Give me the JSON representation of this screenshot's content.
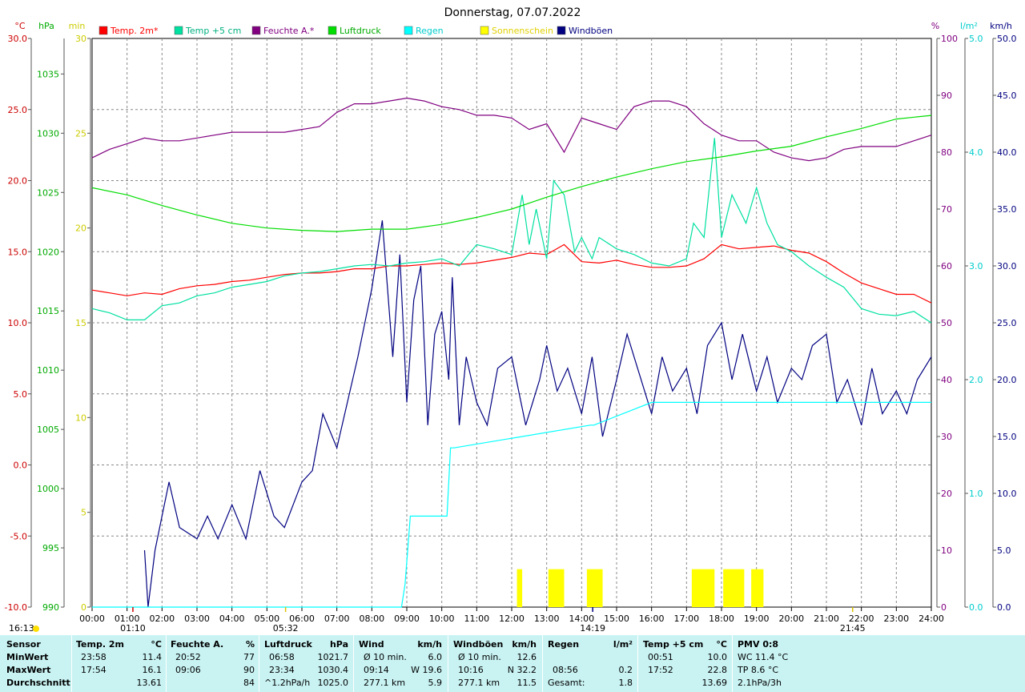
{
  "chart_data": {
    "type": "line",
    "title": "Donnerstag, 07.07.2022",
    "x_ticks": [
      "00:00",
      "01:00",
      "02:00",
      "03:00",
      "04:00",
      "05:00",
      "06:00",
      "07:00",
      "08:00",
      "09:00",
      "10:00",
      "11:00",
      "12:00",
      "13:00",
      "14:00",
      "15:00",
      "16:00",
      "17:00",
      "18:00",
      "19:00",
      "20:00",
      "21:00",
      "22:00",
      "23:00",
      "24:00"
    ],
    "axes": {
      "temp": {
        "unit": "°C",
        "min": -10,
        "max": 30,
        "ticks": [
          "-10.0",
          "-5.0",
          "0.0",
          "5.0",
          "10.0",
          "15.0",
          "20.0",
          "25.0",
          "30.0"
        ],
        "color": "#cc0000"
      },
      "pressure": {
        "unit": "hPa",
        "min": 990,
        "max": 1038,
        "ticks": [
          "990",
          "995",
          "1000",
          "1005",
          "1010",
          "1015",
          "1020",
          "1025",
          "1030",
          "1035"
        ],
        "color": "#00aa00"
      },
      "sunshine": {
        "unit": "min",
        "min": 0,
        "max": 30,
        "ticks": [
          "0",
          "5",
          "10",
          "15",
          "20",
          "25",
          "30"
        ],
        "color": "#cccc00"
      },
      "humidity": {
        "unit": "%",
        "min": 0,
        "max": 100,
        "ticks": [
          "0",
          "10",
          "20",
          "30",
          "40",
          "50",
          "60",
          "70",
          "80",
          "90",
          "100"
        ],
        "color": "#800080"
      },
      "rain": {
        "unit": "l/m²",
        "min": 0,
        "max": 5,
        "ticks": [
          "0.0",
          "1.0",
          "2.0",
          "3.0",
          "4.0",
          "5.0"
        ],
        "color": "#00cccc"
      },
      "wind": {
        "unit": "km/h",
        "min": 0,
        "max": 50,
        "ticks": [
          "0.0",
          "5.0",
          "10.0",
          "15.0",
          "20.0",
          "25.0",
          "30.0",
          "35.0",
          "40.0",
          "45.0",
          "50.0"
        ],
        "color": "#000080"
      }
    },
    "legend": [
      {
        "name": "Temp. 2m*",
        "color": "#ff0000"
      },
      {
        "name": "Temp +5 cm",
        "color": "#00e0a0"
      },
      {
        "name": "Feuchte A.*",
        "color": "#800080"
      },
      {
        "name": "Luftdruck",
        "color": "#00dd00"
      },
      {
        "name": "Regen",
        "color": "#00ffff"
      },
      {
        "name": "Sonnenschein",
        "color": "#ffff00"
      },
      {
        "name": "Windböen",
        "color": "#000080"
      }
    ],
    "series": [
      {
        "name": "Temp. 2m*",
        "axis": "temp",
        "color": "#ff0000",
        "x": [
          0,
          0.5,
          1,
          1.5,
          2,
          2.5,
          3,
          3.5,
          4,
          4.5,
          5,
          5.5,
          6,
          6.5,
          7,
          7.5,
          8,
          8.5,
          9,
          9.5,
          10,
          10.5,
          11,
          11.5,
          12,
          12.5,
          13,
          13.5,
          14,
          14.5,
          15,
          15.5,
          16,
          16.5,
          17,
          17.5,
          18,
          18.5,
          19,
          19.5,
          20,
          20.5,
          21,
          21.5,
          22,
          22.5,
          23,
          23.5,
          24
        ],
        "values": [
          12.3,
          12.1,
          11.9,
          12.1,
          12.0,
          12.4,
          12.6,
          12.7,
          12.9,
          13.0,
          13.2,
          13.4,
          13.5,
          13.5,
          13.6,
          13.8,
          13.8,
          14.0,
          14.0,
          14.1,
          14.2,
          14.1,
          14.2,
          14.4,
          14.6,
          14.9,
          14.8,
          15.5,
          14.3,
          14.2,
          14.4,
          14.1,
          13.9,
          13.9,
          14.0,
          14.5,
          15.5,
          15.2,
          15.3,
          15.4,
          15.1,
          14.9,
          14.3,
          13.5,
          12.8,
          12.4,
          12.0,
          12.0,
          11.4
        ]
      },
      {
        "name": "Temp +5 cm",
        "axis": "temp",
        "color": "#00e0a0",
        "x": [
          0,
          0.5,
          1,
          1.5,
          2,
          2.5,
          3,
          3.5,
          4,
          4.5,
          5,
          5.5,
          6,
          6.5,
          7,
          7.5,
          8,
          8.5,
          9,
          9.5,
          10,
          10.5,
          11,
          11.5,
          12,
          12.3,
          12.5,
          12.7,
          13,
          13.2,
          13.5,
          13.8,
          14,
          14.3,
          14.5,
          15,
          15.5,
          16,
          16.5,
          17,
          17.2,
          17.5,
          17.8,
          18,
          18.3,
          18.7,
          19,
          19.3,
          19.6,
          20,
          20.5,
          21,
          21.5,
          22,
          22.5,
          23,
          23.5,
          24
        ],
        "values": [
          11.0,
          10.7,
          10.2,
          10.2,
          11.2,
          11.4,
          11.9,
          12.1,
          12.5,
          12.7,
          12.9,
          13.3,
          13.5,
          13.6,
          13.8,
          14.0,
          14.1,
          14.0,
          14.2,
          14.3,
          14.5,
          14.0,
          15.5,
          15.2,
          14.8,
          19.0,
          15.5,
          18.0,
          14.5,
          20.0,
          19.0,
          15.0,
          16.0,
          14.5,
          16.0,
          15.2,
          14.8,
          14.2,
          14.0,
          14.5,
          17.0,
          16.0,
          23.0,
          16.0,
          19.0,
          17.0,
          19.5,
          17.0,
          15.5,
          15.0,
          14.0,
          13.2,
          12.5,
          11.0,
          10.6,
          10.5,
          10.8,
          10.0
        ]
      },
      {
        "name": "Feuchte A.*",
        "axis": "humidity",
        "color": "#800080",
        "x": [
          0,
          0.5,
          1,
          1.5,
          2,
          2.5,
          3,
          3.5,
          4,
          4.5,
          5,
          5.5,
          6,
          6.5,
          7,
          7.5,
          8,
          8.5,
          9,
          9.5,
          10,
          10.5,
          11,
          11.5,
          12,
          12.5,
          13,
          13.5,
          14,
          14.5,
          15,
          15.5,
          16,
          16.5,
          17,
          17.5,
          18,
          18.5,
          19,
          19.5,
          20,
          20.5,
          21,
          21.5,
          22,
          22.5,
          23,
          23.5,
          24
        ],
        "values": [
          79,
          80.5,
          81.5,
          82.5,
          82,
          82,
          82.5,
          83,
          83.5,
          83.5,
          83.5,
          83.5,
          84,
          84.5,
          87,
          88.5,
          88.5,
          89,
          89.5,
          89,
          88,
          87.5,
          86.5,
          86.5,
          86,
          84,
          85,
          80,
          86,
          85,
          84,
          88,
          89,
          89,
          88,
          85,
          83,
          82,
          82,
          80,
          79,
          78.5,
          79,
          80.5,
          81,
          81,
          81,
          82,
          83
        ]
      },
      {
        "name": "Luftdruck",
        "axis": "pressure",
        "color": "#00dd00",
        "x": [
          0,
          1,
          2,
          3,
          4,
          5,
          6,
          7,
          8,
          9,
          10,
          11,
          12,
          13,
          14,
          15,
          16,
          17,
          18,
          19,
          20,
          21,
          22,
          23,
          24
        ],
        "values": [
          1025.4,
          1024.8,
          1023.9,
          1023.1,
          1022.4,
          1022.0,
          1021.8,
          1021.7,
          1021.9,
          1021.9,
          1022.3,
          1022.9,
          1023.6,
          1024.6,
          1025.5,
          1026.3,
          1027.0,
          1027.6,
          1028.0,
          1028.5,
          1028.9,
          1029.7,
          1030.4,
          1031.2,
          1031.5
        ]
      },
      {
        "name": "Regen",
        "axis": "rain",
        "color": "#00ffff",
        "x": [
          0,
          8.85,
          8.95,
          9.1,
          10.15,
          10.25,
          10.35,
          14.25,
          14.35,
          16.0,
          16.1,
          24
        ],
        "values": [
          0,
          0,
          0.2,
          0.8,
          0.8,
          1.4,
          1.4,
          1.6,
          1.6,
          1.8,
          1.8,
          1.8
        ]
      },
      {
        "name": "Sonnenschein",
        "axis": "sunshine",
        "color": "#ffff00",
        "x": [
          12.15,
          12.3,
          13.05,
          13.5,
          14.15,
          14.6,
          17.15,
          17.8,
          18.05,
          18.65,
          18.85,
          19.2
        ],
        "values": [
          2,
          2,
          2,
          2,
          2,
          2,
          2,
          2,
          2,
          2,
          2,
          2
        ]
      },
      {
        "name": "Windböen",
        "axis": "wind",
        "color": "#000080",
        "x": [
          0,
          1.5,
          1.6,
          1.8,
          2.0,
          2.2,
          2.5,
          3.0,
          3.3,
          3.6,
          4.0,
          4.4,
          4.8,
          5.2,
          5.5,
          6.0,
          6.3,
          6.6,
          7.0,
          7.3,
          7.6,
          8.0,
          8.3,
          8.6,
          8.8,
          9.0,
          9.2,
          9.4,
          9.6,
          9.8,
          10.0,
          10.2,
          10.3,
          10.5,
          10.7,
          11.0,
          11.3,
          11.6,
          12.0,
          12.2,
          12.4,
          12.6,
          12.8,
          13.0,
          13.3,
          13.6,
          14.0,
          14.3,
          14.6,
          15.0,
          15.3,
          15.6,
          16.0,
          16.3,
          16.6,
          17.0,
          17.3,
          17.6,
          18.0,
          18.3,
          18.6,
          19.0,
          19.3,
          19.6,
          20.0,
          20.3,
          20.6,
          21.0,
          21.3,
          21.6,
          22.0,
          22.3,
          22.6,
          23.0,
          23.3,
          23.6,
          24.0
        ],
        "values": [
          null,
          5,
          0,
          5,
          8,
          11,
          7,
          6,
          8,
          6,
          9,
          6,
          12,
          8,
          7,
          11,
          12,
          17,
          14,
          18,
          22,
          28,
          34,
          22,
          31,
          18,
          27,
          30,
          16,
          24,
          26,
          20,
          29,
          16,
          22,
          18,
          16,
          21,
          22,
          19,
          16,
          18,
          20,
          23,
          19,
          21,
          17,
          22,
          15,
          20,
          24,
          21,
          17,
          22,
          19,
          21,
          17,
          23,
          25,
          20,
          24,
          19,
          22,
          18,
          21,
          20,
          23,
          24,
          18,
          20,
          16,
          21,
          17,
          19,
          17,
          20,
          22
        ]
      }
    ]
  },
  "legend_labels": [
    "Temp. 2m*",
    "Temp +5 cm",
    "Feuchte A.*",
    "Luftdruck",
    "Regen",
    "Sonnenschein",
    "Windböen"
  ],
  "markers": {
    "temp_min_time": "01:10",
    "sunrise": "05:32",
    "gust_max_time": "14:19",
    "sunset": "21:45",
    "moon_time": "16:13"
  },
  "summary": {
    "rows": [
      "Sensor",
      "MinWert",
      "MaxWert",
      "Durchschnitt"
    ],
    "temp2m": {
      "title": "Temp. 2m",
      "unit": "°C",
      "min_time": "23:58",
      "min": "11.4",
      "max_time": "17:54",
      "max": "16.1",
      "avg": "13.61"
    },
    "humidity": {
      "title": "Feuchte A.",
      "unit": "%",
      "min_time": "20:52",
      "min": "77",
      "max_time": "09:06",
      "max": "90",
      "avg": "84"
    },
    "pressure": {
      "title": "Luftdruck",
      "unit": "hPa",
      "min_time": "06:58",
      "min": "1021.7",
      "max_time": "23:34",
      "max": "1030.4",
      "trend": "^1.2hPa/h",
      "avg": "1025.0"
    },
    "wind": {
      "title": "Wind",
      "unit": "km/h",
      "r1_label": "Ø 10 min.",
      "r1_value": "6.0",
      "r2_time": "09:14",
      "r2_value": "W 19.6",
      "r3_label": "277.1 km",
      "r3_value": "5.9"
    },
    "gusts": {
      "title": "Windböen",
      "unit": "km/h",
      "r1_label": "Ø 10 min.",
      "r1_value": "12.6",
      "r2_time": "10:16",
      "r2_value": "N 32.2",
      "r3_label": "277.1 km",
      "r3_value": "11.5"
    },
    "rain": {
      "title": "Regen",
      "unit": "l/m²",
      "max_time": "08:56",
      "max": "0.2",
      "total_label": "Gesamt:",
      "total": "1.8"
    },
    "temp5cm": {
      "title": "Temp +5 cm",
      "unit": "°C",
      "min_time": "00:51",
      "min": "10.0",
      "max_time": "17:52",
      "max": "22.8",
      "avg": "13.69"
    },
    "pmv": {
      "title": "PMV 0:8",
      "wc": "WC 11.4 °C",
      "tp": "TP 8.6 °C",
      "trend": "2.1hPa/3h"
    }
  }
}
